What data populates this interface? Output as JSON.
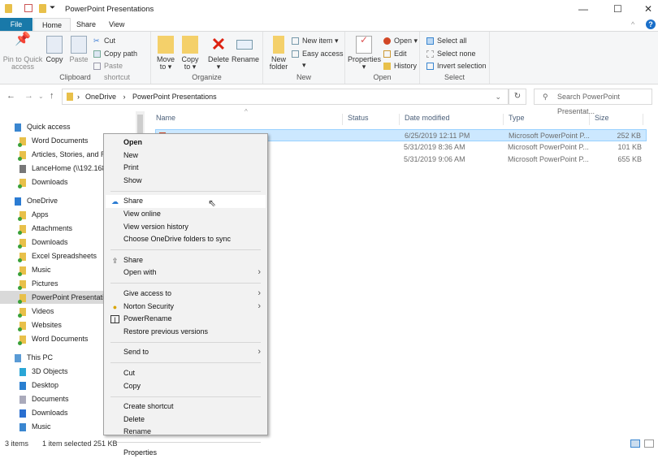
{
  "window": {
    "title": "PowerPoint Presentations",
    "minimize": "—",
    "maximize": "☐",
    "close": "✕",
    "collapse": "^",
    "help": "?"
  },
  "tabs": [
    "File",
    "Home",
    "Share",
    "View"
  ],
  "ribbon": {
    "clipboard": {
      "label": "Clipboard",
      "pin": "Pin to Quick access",
      "copy": "Copy",
      "paste": "Paste",
      "cut": "Cut",
      "copy_path": "Copy path",
      "paste_shortcut": "Paste shortcut"
    },
    "organize": {
      "label": "Organize",
      "move_to": "Move to ▾",
      "copy_to": "Copy to ▾",
      "delete": "Delete ▾",
      "rename": "Rename"
    },
    "new": {
      "label": "New",
      "new_folder": "New folder",
      "new_item": "New item ▾",
      "easy_access": "Easy access ▾"
    },
    "open": {
      "label": "Open",
      "properties": "Properties ▾",
      "open": "Open ▾",
      "edit": "Edit",
      "history": "History"
    },
    "select": {
      "label": "Select",
      "select_all": "Select all",
      "select_none": "Select none",
      "invert": "Invert selection"
    }
  },
  "address": {
    "path": [
      "OneDrive",
      "PowerPoint Presentations"
    ],
    "separator": "›",
    "search_placeholder": "Search PowerPoint Presentat..."
  },
  "nav": [
    {
      "label": "Quick access",
      "level": 0,
      "icon": "star"
    },
    {
      "label": "Word Documents",
      "level": 1,
      "icon": "folder"
    },
    {
      "label": "Articles, Stories, and Re",
      "level": 1,
      "icon": "folder"
    },
    {
      "label": "LanceHome (\\\\192.168.",
      "level": 1,
      "icon": "network"
    },
    {
      "label": "Downloads",
      "level": 1,
      "icon": "folder"
    },
    {
      "label": "OneDrive",
      "level": 0,
      "icon": "cloud"
    },
    {
      "label": "Apps",
      "level": 1,
      "icon": "folder"
    },
    {
      "label": "Attachments",
      "level": 1,
      "icon": "folder"
    },
    {
      "label": "Downloads",
      "level": 1,
      "icon": "folder"
    },
    {
      "label": "Excel Spreadsheets",
      "level": 1,
      "icon": "folder"
    },
    {
      "label": "Music",
      "level": 1,
      "icon": "folder"
    },
    {
      "label": "Pictures",
      "level": 1,
      "icon": "folder"
    },
    {
      "label": "PowerPoint Presentatio",
      "level": 1,
      "icon": "folder",
      "selected": true
    },
    {
      "label": "Videos",
      "level": 1,
      "icon": "folder"
    },
    {
      "label": "Websites",
      "level": 1,
      "icon": "folder"
    },
    {
      "label": "Word Documents",
      "level": 1,
      "icon": "folder"
    },
    {
      "label": "This PC",
      "level": 0,
      "icon": "pc"
    },
    {
      "label": "3D Objects",
      "level": 1,
      "icon": "cube"
    },
    {
      "label": "Desktop",
      "level": 1,
      "icon": "desktop"
    },
    {
      "label": "Documents",
      "level": 1,
      "icon": "docs"
    },
    {
      "label": "Downloads",
      "level": 1,
      "icon": "download"
    },
    {
      "label": "Music",
      "level": 1,
      "icon": "music"
    }
  ],
  "columns": [
    "Name",
    "Status",
    "Date modified",
    "Type",
    "Size"
  ],
  "files": [
    {
      "name": "",
      "date": "6/25/2019 12:11 PM",
      "type": "Microsoft PowerPoint P...",
      "size": "252 KB",
      "selected": true
    },
    {
      "name": "",
      "date": "5/31/2019 8:36 AM",
      "type": "Microsoft PowerPoint P...",
      "size": "101 KB"
    },
    {
      "name": "",
      "date": "5/31/2019 9:06 AM",
      "type": "Microsoft PowerPoint P...",
      "size": "655 KB"
    }
  ],
  "context_menu": [
    {
      "label": "Open",
      "bold": true
    },
    {
      "label": "New"
    },
    {
      "label": "Print"
    },
    {
      "label": "Show"
    },
    {
      "sep": true
    },
    {
      "label": "Share",
      "icon": "onedrive",
      "hot": true
    },
    {
      "label": "View online"
    },
    {
      "label": "View version history"
    },
    {
      "label": "Choose OneDrive folders to sync"
    },
    {
      "sep": true
    },
    {
      "label": "Share",
      "icon": "share"
    },
    {
      "label": "Open with",
      "sub": true
    },
    {
      "sep": true
    },
    {
      "label": "Give access to",
      "sub": true
    },
    {
      "label": "Norton Security",
      "icon": "norton",
      "sub": true
    },
    {
      "label": "PowerRename",
      "icon": "powerrename"
    },
    {
      "label": "Restore previous versions"
    },
    {
      "sep": true
    },
    {
      "label": "Send to",
      "sub": true
    },
    {
      "sep": true
    },
    {
      "label": "Cut"
    },
    {
      "label": "Copy"
    },
    {
      "sep": true
    },
    {
      "label": "Create shortcut"
    },
    {
      "label": "Delete"
    },
    {
      "label": "Rename"
    },
    {
      "sep": true
    },
    {
      "label": "Properties"
    }
  ],
  "status": {
    "items": "3 items",
    "selected": "1 item selected  251 KB"
  },
  "colors": {
    "accent": "#1979a9",
    "selection": "#cce8ff",
    "nav_selected": "#d9d9d9"
  }
}
